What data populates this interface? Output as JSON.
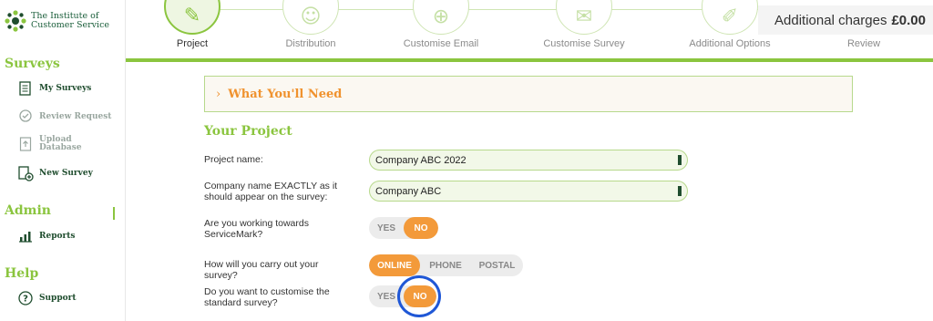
{
  "sidebar": {
    "logo_line1": "The Institute of",
    "logo_line2": "Customer Service",
    "surveys_heading": "Surveys",
    "my_surveys": "My Surveys",
    "review_request": "Review Request",
    "upload_line1": "Upload",
    "upload_line2": "Database",
    "new_survey": "New Survey",
    "admin_heading": "Admin",
    "reports": "Reports",
    "help_heading": "Help",
    "support": "Support"
  },
  "steps": [
    "Project",
    "Distribution",
    "Customise Email",
    "Customise Survey",
    "Additional Options",
    "Review"
  ],
  "charges": {
    "label": "Additional charges",
    "amount": "£0.00"
  },
  "section": {
    "need": "What You'll Need",
    "your_project": "Your Project"
  },
  "form": {
    "project_name_label": "Project name:",
    "project_name_value": "Company ABC 2022",
    "company_label": "Company name EXACTLY as it should appear on the survey:",
    "company_value": "Company ABC",
    "servicemark_label": "Are you working towards ServiceMark?",
    "servicemark_yes": "YES",
    "servicemark_no": "NO",
    "method_label": "How will you carry out your survey?",
    "method_online": "ONLINE",
    "method_phone": "PHONE",
    "method_postal": "POSTAL",
    "customise_label": "Do you want to customise the standard survey?",
    "customise_yes": "YES",
    "customise_no": "NO"
  },
  "colors": {
    "brand_green": "#8bc53f",
    "accent_orange": "#f39a3a",
    "dark_green": "#1f4d2e",
    "highlight_blue": "#1f57d6"
  }
}
